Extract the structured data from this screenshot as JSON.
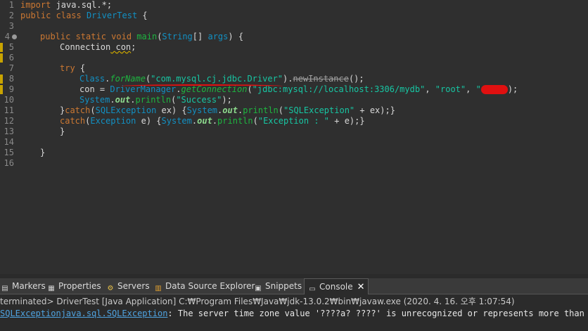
{
  "editor": {
    "line_numbers": [
      "1",
      "2",
      "3",
      "4",
      "5",
      "6",
      "7",
      "8",
      "9",
      "10",
      "11",
      "12",
      "13",
      "14",
      "15",
      "16"
    ],
    "line1": {
      "kw": "import",
      "rest": " java.sql.*;"
    },
    "line2": {
      "kw1": "public",
      "kw2": " class",
      "name": " DriverTest",
      "rest": " {"
    },
    "line4": {
      "kw1": "public",
      "kw2": " static",
      "kw3": " void",
      "fn": " main",
      "p1": "(",
      "ty": "String",
      "p2": "[] ",
      "arg": "args",
      "p3": ") {"
    },
    "line5": {
      "ty": "Connection",
      "var": " con",
      "semi": ";"
    },
    "line7": {
      "kw": "try",
      "rest": " {"
    },
    "line8": {
      "ty": "Class",
      "dot": ".",
      "fn": "forName",
      "p1": "(",
      "str": "\"com.mysql.cj.jdbc.Driver\"",
      "p2": ").",
      "dep": "newInstance",
      "p3": "();"
    },
    "line9": {
      "pre": "con = ",
      "ty": "DriverManager",
      "dot": ".",
      "fn": "getConnection",
      "p1": "(",
      "s1": "\"jdbc:mysql://localhost:3306/mydb\"",
      "c1": ", ",
      "s2": "\"root\"",
      "c2": ", ",
      "s3": "\"",
      "end": ");"
    },
    "line10": {
      "ty": "System",
      "dot": ".",
      "fld": "out",
      "dot2": ".",
      "fn": "println",
      "p1": "(",
      "str": "\"Success\"",
      "p2": ");"
    },
    "line11": {
      "pre": "}",
      "kw": "catch",
      "p1": "(",
      "ty": "SQLException",
      "arg": " ex",
      "p2": ") {",
      "ty2": "System",
      "dot": ".",
      "fld": "out",
      "dot2": ".",
      "fn": "println",
      "p3": "(",
      "str": "\"SQLException\"",
      "p4": " + ex);}"
    },
    "line12": {
      "kw": "catch",
      "p1": "(",
      "ty": "Exception",
      "arg": " e",
      "p2": ") {",
      "ty2": "System",
      "dot": ".",
      "fld": "out",
      "dot2": ".",
      "fn": "println",
      "p3": "(",
      "str": "\"Exception : \"",
      "p4": " + e);}"
    },
    "line13": "}",
    "line15": "}"
  },
  "panel": {
    "tabs": [
      {
        "label": "Markers",
        "icon": "markers-icon"
      },
      {
        "label": "Properties",
        "icon": "properties-icon"
      },
      {
        "label": "Servers",
        "icon": "servers-icon"
      },
      {
        "label": "Data Source Explorer",
        "icon": "data-source-explorer-icon"
      },
      {
        "label": "Snippets",
        "icon": "snippets-icon"
      },
      {
        "label": "Console",
        "icon": "console-icon"
      }
    ],
    "status": "terminated> DriverTest [Java Application] C:₩Program Files₩Java₩jdk-13.0.2₩bin₩javaw.exe (2020. 4. 16. 오후 1:07:54)",
    "console_link": "SQLExceptionjava.sql.SQLException",
    "console_msg": ": The server time zone value '????a? ????' is unrecognized or represents more than one t"
  },
  "colors": {
    "background": "#2f2f2f",
    "redaction": "#e01010",
    "warning": "#c9a400"
  }
}
